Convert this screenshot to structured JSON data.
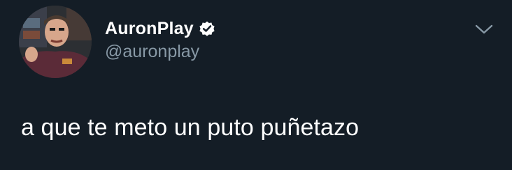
{
  "tweet": {
    "display_name": "AuronPlay",
    "handle": "@auronplay",
    "verified": true,
    "text": "a que te meto un puto puñetazo"
  },
  "icons": {
    "verified": "verified-badge-icon",
    "menu": "chevron-down-icon"
  },
  "colors": {
    "background": "#141d26",
    "name": "#ffffff",
    "handle": "#8899a6",
    "text": "#ffffff"
  }
}
